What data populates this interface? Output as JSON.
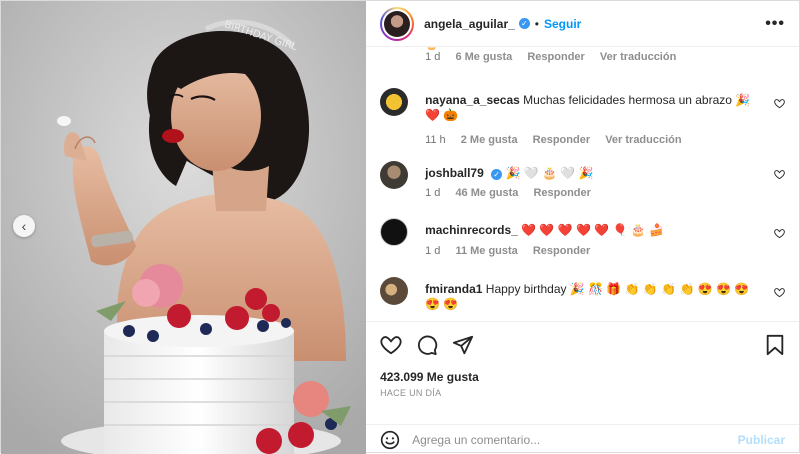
{
  "post": {
    "author": "angela_aguilar_",
    "follow_label": "Seguir",
    "separator": "•",
    "more": "•••"
  },
  "media": {
    "prev_glyph": "‹",
    "tiara_text": "BIRTHDAY GIRL"
  },
  "comments": [
    {
      "user": "",
      "text": "",
      "meta": [
        "1 d",
        "6 Me gusta",
        "Responder",
        "Ver traducción"
      ]
    },
    {
      "user": "nayana_a_secas",
      "text": "Muchas felicidades hermosa un abrazo 🎉 ❤️ 🎃",
      "meta": [
        "11 h",
        "2 Me gusta",
        "Responder",
        "Ver traducción"
      ]
    },
    {
      "user": "joshball79",
      "text": "🎉 🤍 🎂 🤍 🎉",
      "meta": [
        "1 d",
        "46 Me gusta",
        "Responder"
      ]
    },
    {
      "user": "machinrecords_",
      "text": "❤️ ❤️ ❤️ ❤️ ❤️ 🎈 🎂 🍰",
      "meta": [
        "1 d",
        "11 Me gusta",
        "Responder"
      ]
    },
    {
      "user": "fmiranda1",
      "text": "Happy birthday 🎉 🎊 🎁 👏 👏 👏 👏 😍 😍 😍 😍 😍",
      "meta": []
    }
  ],
  "actions": {
    "likes": "423.099 Me gusta",
    "ago": "HACE UN DÍA"
  },
  "composer": {
    "placeholder": "Agrega un comentario...",
    "publish": "Publicar"
  },
  "colors": {
    "link_blue": "#0095f6",
    "verified_blue": "#3897f0",
    "muted": "#737373",
    "publish_disabled": "#b2dffc"
  },
  "icons": [
    "heart-icon",
    "comment-icon",
    "share-icon",
    "bookmark-icon",
    "emoji-icon",
    "verified-icon",
    "more-icon",
    "chevron-left-icon"
  ]
}
